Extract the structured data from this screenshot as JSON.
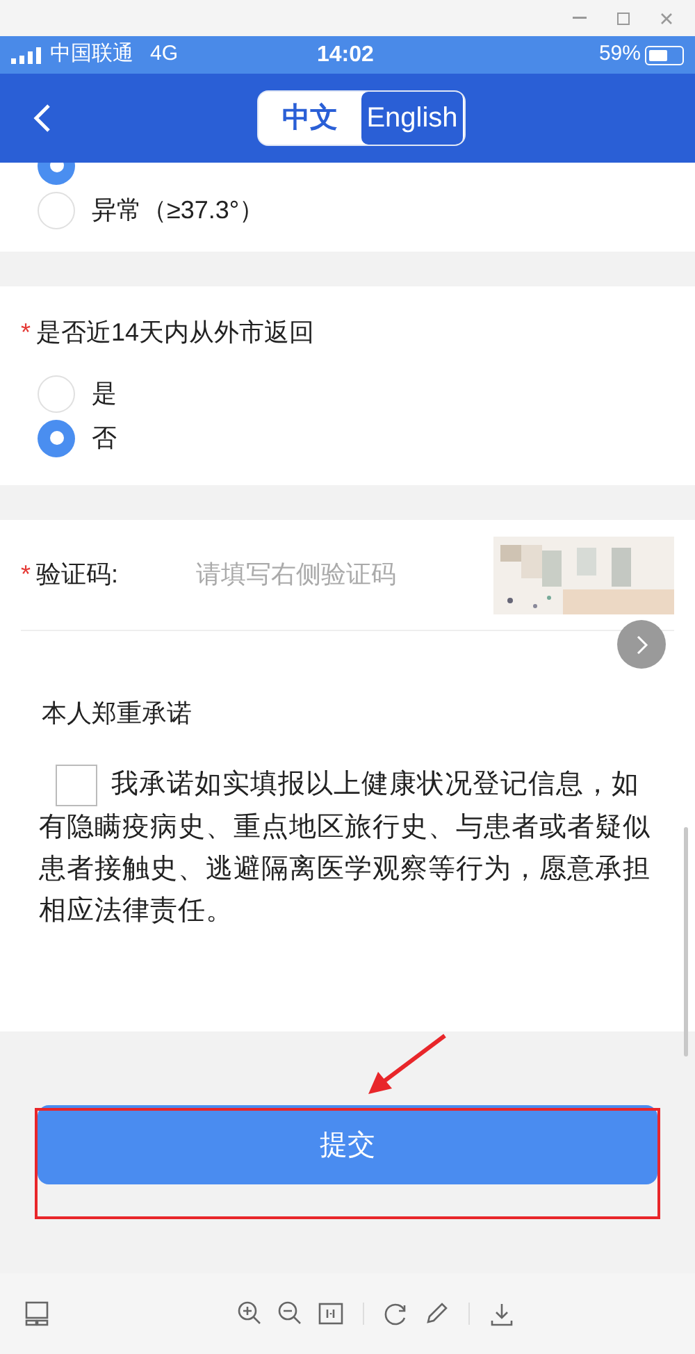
{
  "status_bar": {
    "carrier": "中国联通",
    "network": "4G",
    "time": "14:02",
    "battery": "59%"
  },
  "nav": {
    "languages": [
      {
        "label": "中文",
        "selected": true
      },
      {
        "label": "English",
        "selected": false
      }
    ]
  },
  "temperature_options": [
    {
      "selected": true
    },
    {
      "label": "异常（≥37.3°）",
      "selected": false
    }
  ],
  "travel_question": {
    "required_mark": "*",
    "label": "是否近14天内从外市返回",
    "options": [
      {
        "label": "是",
        "selected": false
      },
      {
        "label": "否",
        "selected": true
      }
    ]
  },
  "captcha": {
    "required_mark": "*",
    "label": "验证码:",
    "placeholder": "请填写右侧验证码"
  },
  "pledge": {
    "title": "本人郑重承诺",
    "checked": false,
    "text": "我承诺如实填报以上健康状况登记信息，如有隐瞒疫病史、重点地区旅行史、与患者或者疑似患者接触史、逃避隔离医学观察等行为，愿意承担相应法律责任。"
  },
  "submit": {
    "label": "提交"
  }
}
